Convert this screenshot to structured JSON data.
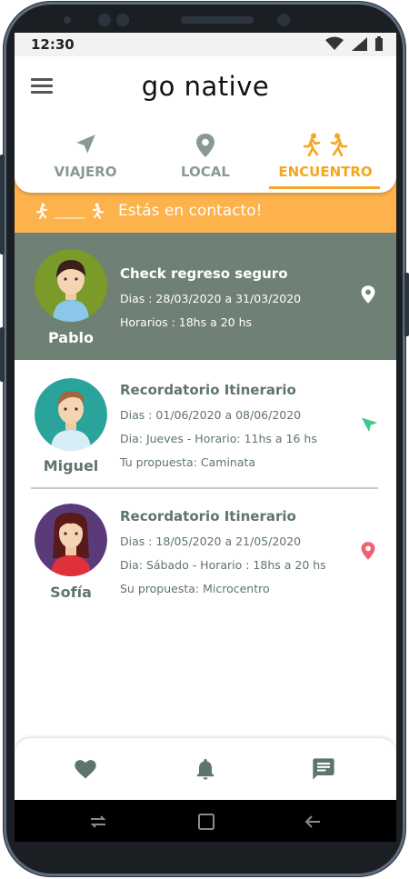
{
  "status": {
    "time": "12:30"
  },
  "app": {
    "logo": "go native"
  },
  "tabs": [
    {
      "label": "VIAJERO",
      "icon": "navigation-arrow-icon",
      "active": false
    },
    {
      "label": "LOCAL",
      "icon": "location-pin-icon",
      "active": false
    },
    {
      "label": "ENCUENTRO",
      "icon": "walking-people-icon",
      "active": true
    }
  ],
  "banner": {
    "dashes": "____",
    "text": "Estás en contacto!"
  },
  "contacts": [
    {
      "name": "Pablo",
      "title": "Check regreso seguro",
      "lines": [
        "Dias : 28/03/2020  a 31/03/2020",
        "Horarios : 18hs a 20 hs"
      ],
      "icon": "location-pin-icon",
      "icon_color": "#ffffff",
      "highlighted": true
    },
    {
      "name": "Miguel",
      "title": "Recordatorio Itinerario",
      "lines": [
        "Dias : 01/06/2020  a 08/06/2020",
        "Dia: Jueves - Horario: 11hs a 16 hs",
        "Tu propuesta: Caminata"
      ],
      "icon": "navigation-arrow-icon",
      "icon_color": "#3ec98a",
      "highlighted": false
    },
    {
      "name": "Sofía",
      "title": "Recordatorio Itinerario",
      "lines": [
        "Dias : 18/05/2020  a 21/05/2020",
        "Dia: Sábado - Horario : 18hs a 20 hs",
        "Su propuesta: Microcentro"
      ],
      "icon": "location-pin-icon",
      "icon_color": "#f0626e",
      "highlighted": false
    }
  ],
  "bottom_nav": [
    "heart-icon",
    "bell-icon",
    "chat-icon"
  ],
  "colors": {
    "accent": "#f5a623",
    "banner": "#fdb24b",
    "highlight_card": "#6f8075",
    "text_teal": "#5f7470",
    "tab_inactive": "#8a9898"
  }
}
